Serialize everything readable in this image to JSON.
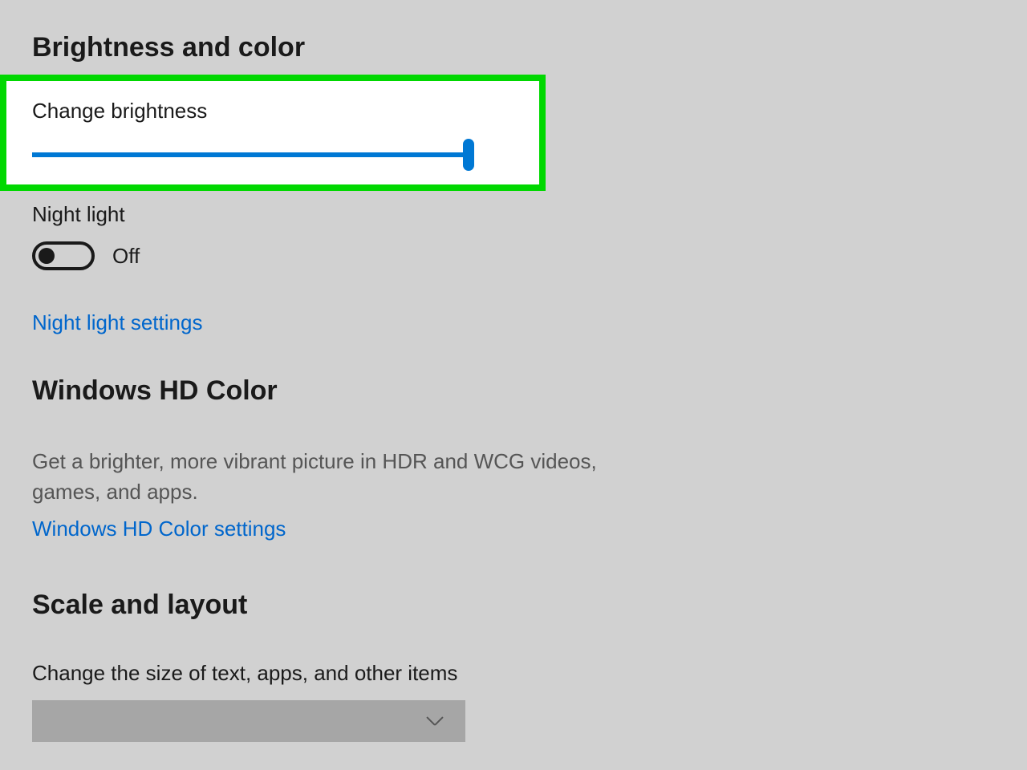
{
  "section1": {
    "title": "Brightness and color",
    "brightness_label": "Change brightness",
    "brightness_value": 100,
    "night_light_label": "Night light",
    "night_light_state": "Off",
    "night_light_link": "Night light settings"
  },
  "section2": {
    "title": "Windows HD Color",
    "description": "Get a brighter, more vibrant picture in HDR and WCG videos, games, and apps.",
    "link": "Windows HD Color settings"
  },
  "section3": {
    "title": "Scale and layout",
    "dropdown_label": "Change the size of text, apps, and other items",
    "dropdown_selected": ""
  },
  "colors": {
    "accent": "#0078d4",
    "link": "#0066cc",
    "highlight_border": "#00d800"
  }
}
